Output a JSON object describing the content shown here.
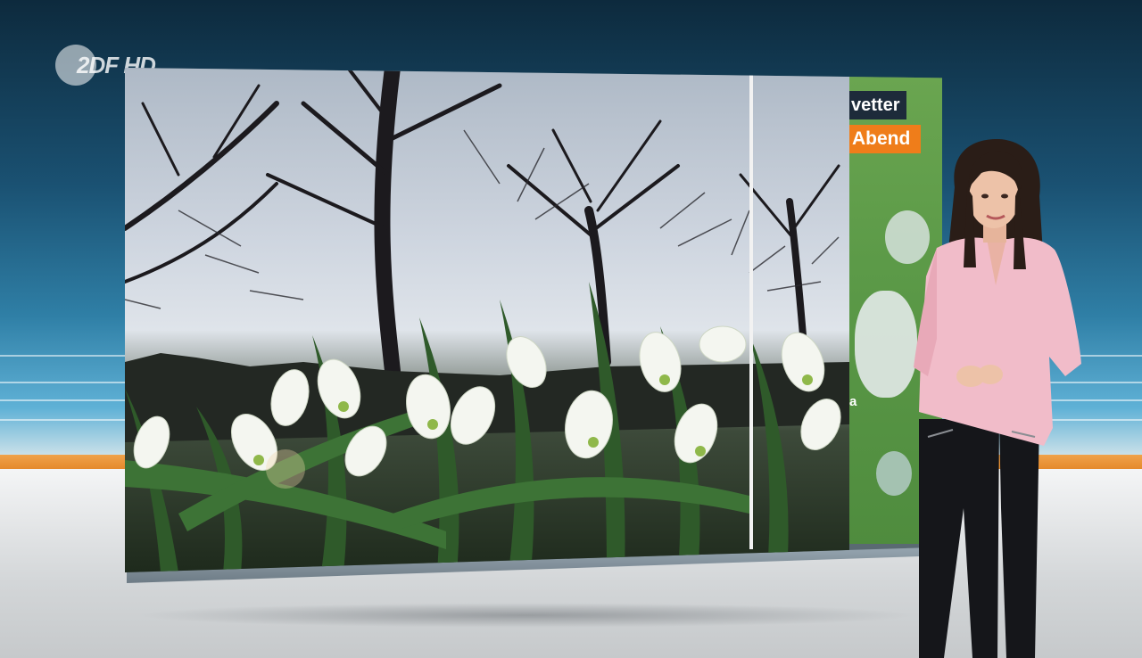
{
  "broadcaster": {
    "logo_text": "2DF HD",
    "logo_icon": "zdf-logo-icon"
  },
  "weather_panel": {
    "title_fragment": "vetter",
    "time_label": "Abend",
    "map_label_fragment": "a"
  },
  "colors": {
    "accent_orange": "#ef7d1a",
    "label_navy": "#1d2b3a",
    "studio_blue": "#2f7fa6",
    "map_green": "#5c9a48",
    "blouse_pink": "#f1bcc9"
  }
}
